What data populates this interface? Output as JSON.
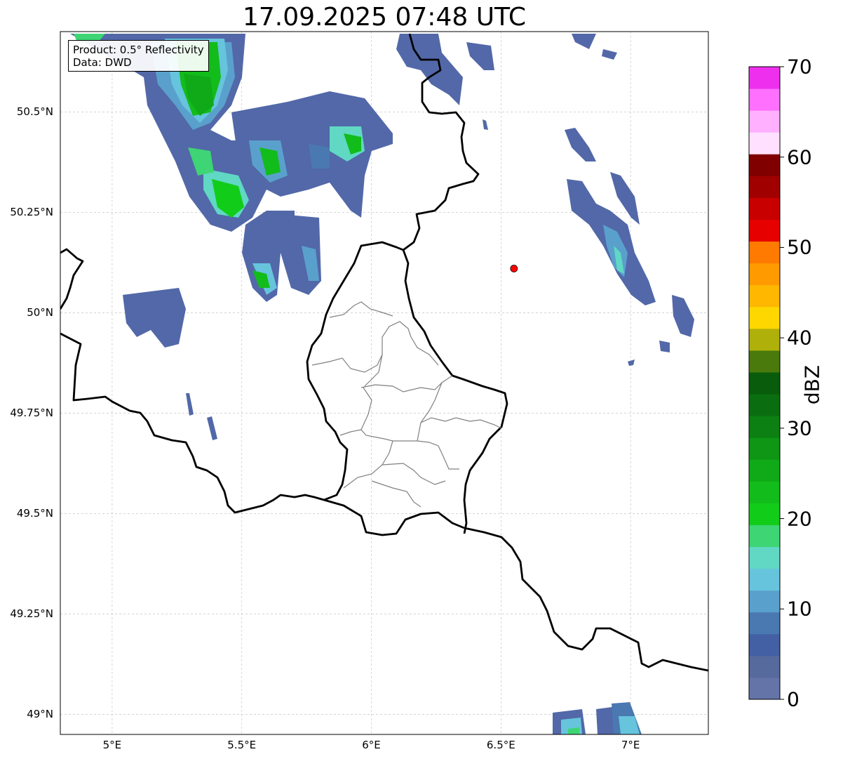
{
  "title": "17.09.2025 07:48 UTC",
  "info_box": {
    "line1": "Product: 0.5° Reflectivity",
    "line2": "Data: DWD"
  },
  "lat_ticks": [
    {
      "value": 50.5,
      "label": "50.5°N"
    },
    {
      "value": 50.25,
      "label": "50.25°N"
    },
    {
      "value": 50.0,
      "label": "50°N"
    },
    {
      "value": 49.75,
      "label": "49.75°N"
    },
    {
      "value": 49.5,
      "label": "49.5°N"
    },
    {
      "value": 49.25,
      "label": "49.25°N"
    },
    {
      "value": 49.0,
      "label": "49°N"
    }
  ],
  "lon_ticks": [
    {
      "value": 5.0,
      "label": "5°E"
    },
    {
      "value": 5.5,
      "label": "5.5°E"
    },
    {
      "value": 6.0,
      "label": "6°E"
    },
    {
      "value": 6.5,
      "label": "6.5°E"
    },
    {
      "value": 7.0,
      "label": "7°E"
    }
  ],
  "extent": {
    "lon_min": 4.8,
    "lon_max": 7.3,
    "lat_min": 48.95,
    "lat_max": 50.7
  },
  "radar_site": {
    "lon": 6.55,
    "lat": 50.11,
    "color": "#ff0000"
  },
  "colorbar": {
    "unit_label": "dBZ",
    "min": 0,
    "max": 70,
    "ticks": [
      {
        "value": 0,
        "label": "0"
      },
      {
        "value": 10,
        "label": "10"
      },
      {
        "value": 20,
        "label": "20"
      },
      {
        "value": 30,
        "label": "30"
      },
      {
        "value": 40,
        "label": "40"
      },
      {
        "value": 50,
        "label": "50"
      },
      {
        "value": 60,
        "label": "60"
      },
      {
        "value": 70,
        "label": "70"
      }
    ],
    "colors": [
      "#6474a8",
      "#566a9e",
      "#4460a4",
      "#4a78b0",
      "#5aa0cc",
      "#66c4dc",
      "#60d8c4",
      "#3ed574",
      "#12cc1a",
      "#12bc1a",
      "#10aa18",
      "#0e9614",
      "#0c8012",
      "#0a6e10",
      "#085c0c",
      "#4a7a0c",
      "#b0b00a",
      "#ffd700",
      "#ffb700",
      "#ff9a00",
      "#ff7a00",
      "#e60000",
      "#c80000",
      "#a00000",
      "#800000",
      "#ffe0ff",
      "#ffb0ff",
      "#ff70ff",
      "#ee30ee"
    ]
  },
  "map_colors": {
    "border": "#000000",
    "subdivision": "#808080",
    "grid": "#bbbbbb"
  },
  "icons": {
    "radar_site": "radar-site-marker",
    "north": "none"
  }
}
